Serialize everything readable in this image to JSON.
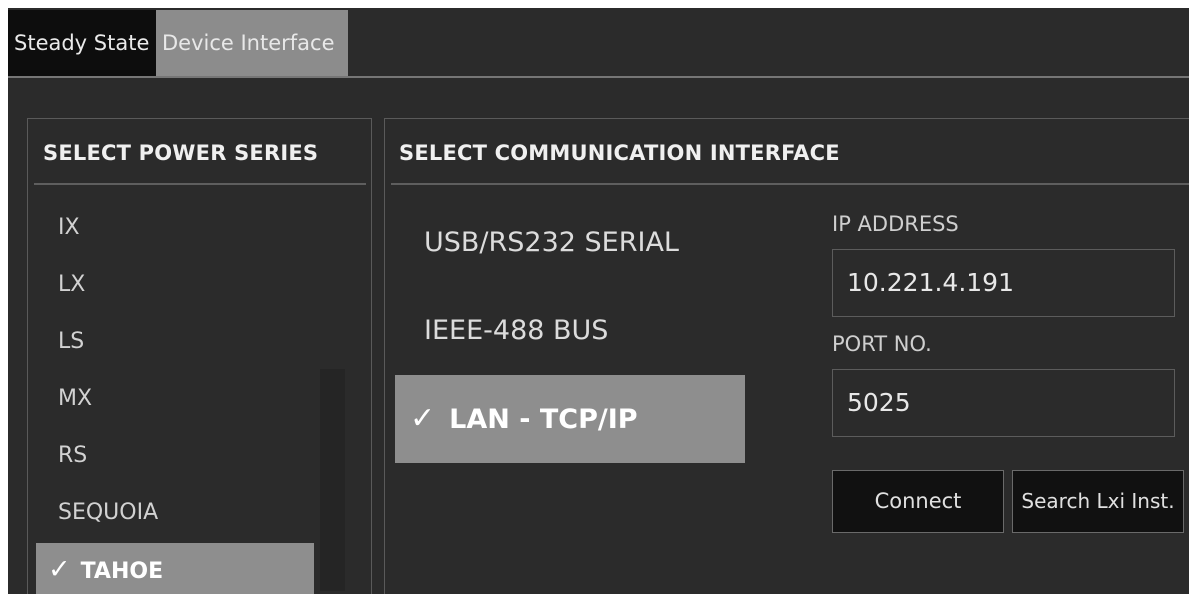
{
  "tabs": [
    {
      "label": "Steady State",
      "active": false
    },
    {
      "label": "Device Interface",
      "active": true
    }
  ],
  "power_series": {
    "title": "SELECT POWER SERIES",
    "items": [
      "IX",
      "LX",
      "LS",
      "MX",
      "RS",
      "SEQUOIA",
      "TAHOE"
    ],
    "selected": "TAHOE",
    "check_icon": "✓"
  },
  "comm_interface": {
    "title": "SELECT COMMUNICATION INTERFACE",
    "options": [
      "USB/RS232 SERIAL",
      "IEEE-488 BUS",
      "LAN - TCP/IP"
    ],
    "selected": "LAN - TCP/IP"
  },
  "ip": {
    "label": "IP ADDRESS",
    "value": "10.221.4.191"
  },
  "port": {
    "label": "PORT NO.",
    "value": "5025"
  },
  "buttons": {
    "connect": "Connect",
    "search": "Search Lxi Inst."
  },
  "colors": {
    "background": "#2b2b2b",
    "selected": "#8e8e8e",
    "active_tab": "#8c8c8c",
    "button": "#111111"
  }
}
